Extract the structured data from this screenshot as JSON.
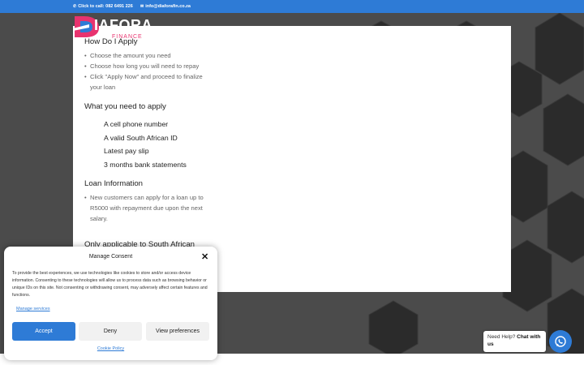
{
  "topbar": {
    "phone_label": "Click to call: 082 6491 226",
    "email_label": "info@diaforafin.co.za",
    "phone_icon": "phone-icon",
    "email_icon": "envelope-icon"
  },
  "logo": {
    "word": "IAFORA",
    "sub": "FINANCE"
  },
  "content": {
    "how_title": "How Do I Apply",
    "how_steps": [
      "Choose the amount you need",
      "Choose how long you will need to repay",
      " Click \"Apply Now\" and proceed to finalize your loan"
    ],
    "need_title": "What you need to apply",
    "need_items": [
      "A cell phone number",
      "A valid South African ID",
      "Latest pay slip",
      "3 months bank statements"
    ],
    "loan_title": "Loan Information",
    "loan_items": [
      "New customers can apply for a loan up to R5000 with repayment due upon the next salary."
    ],
    "only_title": "Only applicable to South African"
  },
  "consent": {
    "title": "Manage Consent",
    "text": "To provide the best experiences, we use technologies like cookies to store and/or access device information. Consenting to these technologies will allow us to process data such as browsing behavior or unique IDs on this site. Not consenting or withdrawing consent, may adversely affect certain features and functions.",
    "manage_label": "Manage services",
    "accept_label": "Accept",
    "deny_label": "Deny",
    "prefs_label": "View preferences",
    "policy_label": "Cookie Policy"
  },
  "chat": {
    "prefix": "Need Help? ",
    "bold": "Chat with us"
  },
  "colors": {
    "brand_blue": "#2e7bd6",
    "brand_pink": "#e8336f",
    "background": "#4b4b4b"
  }
}
